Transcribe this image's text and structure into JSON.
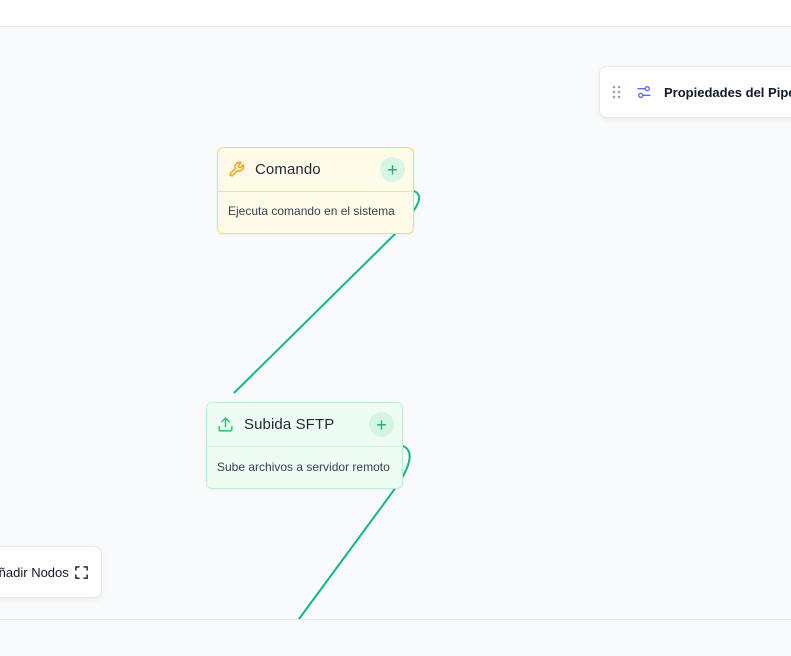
{
  "nodes": [
    {
      "title": "Comando",
      "description": "Ejecuta comando en el sistema",
      "icon": "wrench-icon",
      "color": "#f59e0b",
      "add_label": "+"
    },
    {
      "title": "Subida SFTP",
      "description": "Sube archivos a servidor remoto",
      "icon": "upload-icon",
      "color": "#22c55e",
      "add_label": "+"
    }
  ],
  "properties_panel": {
    "title": "Propiedades del Pipeline",
    "icons": [
      "drag-handle-icon",
      "sliders-icon"
    ]
  },
  "add_nodes_panel": {
    "label": "Añadir Nodos",
    "icon": "expand-icon"
  },
  "colors": {
    "edge": "#10b981",
    "accent": "#6366f1"
  }
}
